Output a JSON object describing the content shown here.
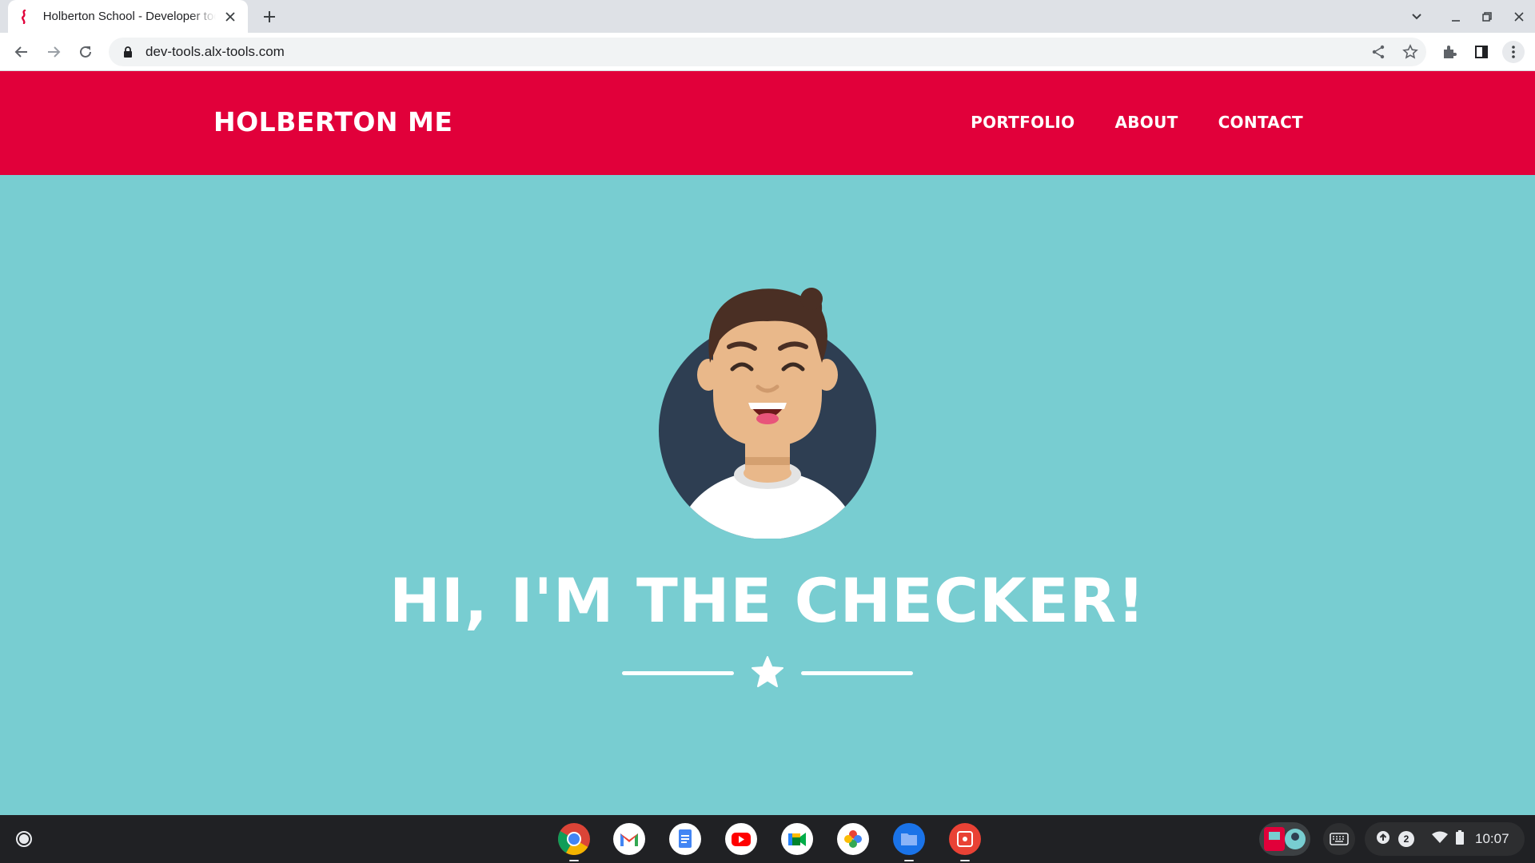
{
  "browser": {
    "tab": {
      "title": "Holberton School - Developer tools"
    },
    "address_bar": {
      "url": "dev-tools.alx-tools.com"
    }
  },
  "site": {
    "brand": "HOLBERTON ME",
    "nav": [
      {
        "label": "PORTFOLIO"
      },
      {
        "label": "ABOUT"
      },
      {
        "label": "CONTACT"
      }
    ],
    "hero_title": "HI, I'M THE CHECKER!"
  },
  "shelf": {
    "apps": [
      "chrome-icon",
      "gmail-icon",
      "docs-icon",
      "youtube-icon",
      "meet-icon",
      "photos-icon",
      "files-icon",
      "screencast-icon"
    ],
    "notification_count": "2",
    "clock": "10:07"
  },
  "colors": {
    "header_red": "#e1003a",
    "hero_teal": "#78cdd1",
    "avatar_navy": "#2e3e52"
  }
}
